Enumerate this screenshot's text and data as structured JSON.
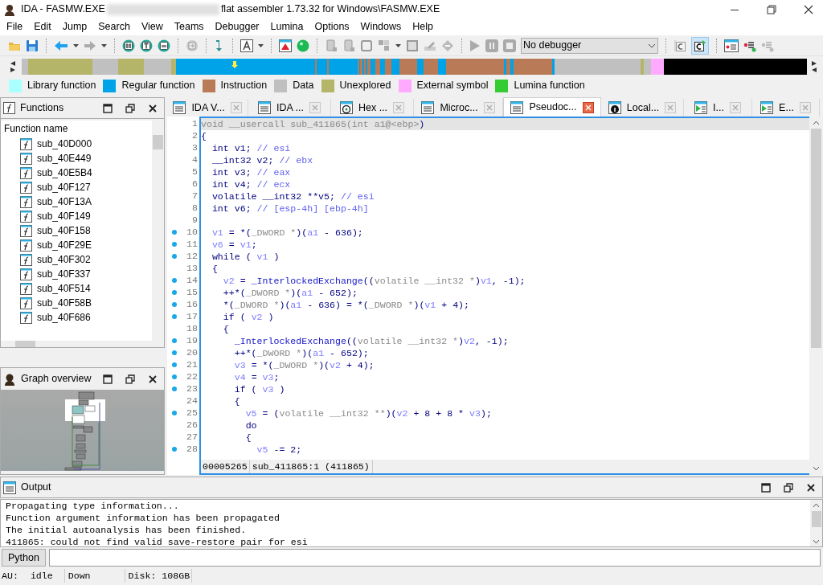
{
  "window": {
    "title_start": "IDA - FASMW.EXE",
    "title_end": "flat assembler 1.73.32 for Windows\\FASMW.EXE"
  },
  "menu": [
    "File",
    "Edit",
    "Jump",
    "Search",
    "View",
    "Teams",
    "Debugger",
    "Lumina",
    "Options",
    "Windows",
    "Help"
  ],
  "toolbar": {
    "debugger_select": "No debugger",
    "pseudocode_toggle_on": true
  },
  "legend": [
    {
      "label": "Library function",
      "color": "#aaffff"
    },
    {
      "label": "Regular function",
      "color": "#00a2e8"
    },
    {
      "label": "Instruction",
      "color": "#b97a57"
    },
    {
      "label": "Data",
      "color": "#c0c0c0"
    },
    {
      "label": "Unexplored",
      "color": "#b5b56a"
    },
    {
      "label": "External symbol",
      "color": "#ffaaff"
    },
    {
      "label": "Lumina function",
      "color": "#33cc33"
    }
  ],
  "functions_panel": {
    "title": "Functions",
    "column": "Function name",
    "items": [
      "sub_40D000",
      "sub_40E449",
      "sub_40E5B4",
      "sub_40F127",
      "sub_40F13A",
      "sub_40F149",
      "sub_40F158",
      "sub_40F29E",
      "sub_40F302",
      "sub_40F337",
      "sub_40F514",
      "sub_40F58B",
      "sub_40F686"
    ]
  },
  "graph_panel": {
    "title": "Graph overview"
  },
  "tabs": [
    {
      "label": "IDA V...",
      "kind": "listing",
      "selected": false
    },
    {
      "label": "IDA ...",
      "kind": "listing",
      "selected": false
    },
    {
      "label": "Hex ...",
      "kind": "hex",
      "selected": false
    },
    {
      "label": "Microc...",
      "kind": "listing",
      "selected": false
    },
    {
      "label": "Pseudoc...",
      "kind": "listing",
      "selected": true
    },
    {
      "label": "Local...",
      "kind": "info",
      "selected": false
    },
    {
      "label": "I...",
      "kind": "table",
      "selected": false
    },
    {
      "label": "E...",
      "kind": "table",
      "selected": false
    }
  ],
  "code": {
    "lines": [
      {
        "number": "1",
        "dot": false,
        "highlighted": true,
        "segments": [
          {
            "kind": "cast",
            "text": "void __usercall sub_411865(int a1@<ebp>"
          },
          {
            "kind": "plain",
            "text": ")"
          }
        ]
      },
      {
        "number": "2",
        "dot": false,
        "highlighted": false,
        "segments": [
          {
            "kind": "plain",
            "text": "{"
          }
        ]
      },
      {
        "number": "3",
        "dot": false,
        "highlighted": false,
        "segments": [
          {
            "kind": "plain",
            "text": "  int v1; "
          },
          {
            "kind": "comment",
            "text": "// esi"
          }
        ]
      },
      {
        "number": "4",
        "dot": false,
        "highlighted": false,
        "segments": [
          {
            "kind": "plain",
            "text": "  __int32 v2; "
          },
          {
            "kind": "comment",
            "text": "// ebx"
          }
        ]
      },
      {
        "number": "5",
        "dot": false,
        "highlighted": false,
        "segments": [
          {
            "kind": "plain",
            "text": "  int v3; "
          },
          {
            "kind": "comment",
            "text": "// eax"
          }
        ]
      },
      {
        "number": "6",
        "dot": false,
        "highlighted": false,
        "segments": [
          {
            "kind": "plain",
            "text": "  int v4; "
          },
          {
            "kind": "comment",
            "text": "// ecx"
          }
        ]
      },
      {
        "number": "7",
        "dot": false,
        "highlighted": false,
        "segments": [
          {
            "kind": "plain",
            "text": "  volatile __int32 **v5; "
          },
          {
            "kind": "comment",
            "text": "// esi"
          }
        ]
      },
      {
        "number": "8",
        "dot": false,
        "highlighted": false,
        "segments": [
          {
            "kind": "plain",
            "text": "  int v6; "
          },
          {
            "kind": "comment",
            "text": "// [esp-4h] [ebp-4h]"
          }
        ]
      },
      {
        "number": "9",
        "dot": false,
        "highlighted": false
      },
      {
        "number": "10",
        "dot": true,
        "highlighted": false,
        "segments": [
          {
            "kind": "var",
            "text": "  v1"
          },
          {
            "kind": "plain",
            "text": " = *("
          },
          {
            "kind": "cast",
            "text": "_DWORD *"
          },
          {
            "kind": "plain",
            "text": ")("
          },
          {
            "kind": "var",
            "text": "a1"
          },
          {
            "kind": "plain",
            "text": " - 636);"
          }
        ]
      },
      {
        "number": "11",
        "dot": true,
        "highlighted": false,
        "segments": [
          {
            "kind": "var",
            "text": "  v6"
          },
          {
            "kind": "plain",
            "text": " = "
          },
          {
            "kind": "var",
            "text": "v1"
          },
          {
            "kind": "plain",
            "text": ";"
          }
        ]
      },
      {
        "number": "12",
        "dot": true,
        "highlighted": false,
        "segments": [
          {
            "kind": "plain",
            "text": "  while ( "
          },
          {
            "kind": "var",
            "text": "v1"
          },
          {
            "kind": "plain",
            "text": " )"
          }
        ]
      },
      {
        "number": "13",
        "dot": false,
        "highlighted": false,
        "segments": [
          {
            "kind": "plain",
            "text": "  {"
          }
        ]
      },
      {
        "number": "14",
        "dot": true,
        "highlighted": false,
        "segments": [
          {
            "kind": "var",
            "text": "    v2"
          },
          {
            "kind": "plain",
            "text": " = "
          },
          {
            "kind": "func",
            "text": "_InterlockedExchange"
          },
          {
            "kind": "plain",
            "text": "(("
          },
          {
            "kind": "cast",
            "text": "volatile __int32 *"
          },
          {
            "kind": "plain",
            "text": ")"
          },
          {
            "kind": "var",
            "text": "v1"
          },
          {
            "kind": "plain",
            "text": ", -1);"
          }
        ]
      },
      {
        "number": "15",
        "dot": true,
        "highlighted": false,
        "segments": [
          {
            "kind": "plain",
            "text": "    ++*("
          },
          {
            "kind": "cast",
            "text": "_DWORD *"
          },
          {
            "kind": "plain",
            "text": ")("
          },
          {
            "kind": "var",
            "text": "a1"
          },
          {
            "kind": "plain",
            "text": " - 652);"
          }
        ]
      },
      {
        "number": "16",
        "dot": true,
        "highlighted": false,
        "segments": [
          {
            "kind": "plain",
            "text": "    *("
          },
          {
            "kind": "cast",
            "text": "_DWORD *"
          },
          {
            "kind": "plain",
            "text": ")("
          },
          {
            "kind": "var",
            "text": "a1"
          },
          {
            "kind": "plain",
            "text": " - 636) = *("
          },
          {
            "kind": "cast",
            "text": "_DWORD *"
          },
          {
            "kind": "plain",
            "text": ")("
          },
          {
            "kind": "var",
            "text": "v1"
          },
          {
            "kind": "plain",
            "text": " + 4);"
          }
        ]
      },
      {
        "number": "17",
        "dot": true,
        "highlighted": false,
        "segments": [
          {
            "kind": "plain",
            "text": "    if ( "
          },
          {
            "kind": "var",
            "text": "v2"
          },
          {
            "kind": "plain",
            "text": " )"
          }
        ]
      },
      {
        "number": "18",
        "dot": false,
        "highlighted": false,
        "segments": [
          {
            "kind": "plain",
            "text": "    {"
          }
        ]
      },
      {
        "number": "19",
        "dot": true,
        "highlighted": false,
        "segments": [
          {
            "kind": "func",
            "text": "      _InterlockedExchange"
          },
          {
            "kind": "plain",
            "text": "(("
          },
          {
            "kind": "cast",
            "text": "volatile __int32 *"
          },
          {
            "kind": "plain",
            "text": ")"
          },
          {
            "kind": "var",
            "text": "v2"
          },
          {
            "kind": "plain",
            "text": ", -1);"
          }
        ]
      },
      {
        "number": "20",
        "dot": true,
        "highlighted": false,
        "segments": [
          {
            "kind": "plain",
            "text": "      ++*("
          },
          {
            "kind": "cast",
            "text": "_DWORD *"
          },
          {
            "kind": "plain",
            "text": ")("
          },
          {
            "kind": "var",
            "text": "a1"
          },
          {
            "kind": "plain",
            "text": " - 652);"
          }
        ]
      },
      {
        "number": "21",
        "dot": true,
        "highlighted": false,
        "segments": [
          {
            "kind": "var",
            "text": "      v3"
          },
          {
            "kind": "plain",
            "text": " = *("
          },
          {
            "kind": "cast",
            "text": "_DWORD *"
          },
          {
            "kind": "plain",
            "text": ")("
          },
          {
            "kind": "var",
            "text": "v2"
          },
          {
            "kind": "plain",
            "text": " + 4);"
          }
        ]
      },
      {
        "number": "22",
        "dot": true,
        "highlighted": false,
        "segments": [
          {
            "kind": "var",
            "text": "      v4"
          },
          {
            "kind": "plain",
            "text": " = "
          },
          {
            "kind": "var",
            "text": "v3"
          },
          {
            "kind": "plain",
            "text": ";"
          }
        ]
      },
      {
        "number": "23",
        "dot": true,
        "highlighted": false,
        "segments": [
          {
            "kind": "plain",
            "text": "      if ( "
          },
          {
            "kind": "var",
            "text": "v3"
          },
          {
            "kind": "plain",
            "text": " )"
          }
        ]
      },
      {
        "number": "24",
        "dot": false,
        "highlighted": false,
        "segments": [
          {
            "kind": "plain",
            "text": "      {"
          }
        ]
      },
      {
        "number": "25",
        "dot": true,
        "highlighted": false,
        "segments": [
          {
            "kind": "var",
            "text": "        v5"
          },
          {
            "kind": "plain",
            "text": " = ("
          },
          {
            "kind": "cast",
            "text": "volatile __int32 **"
          },
          {
            "kind": "plain",
            "text": ")("
          },
          {
            "kind": "var",
            "text": "v2"
          },
          {
            "kind": "plain",
            "text": " + 8 + 8 * "
          },
          {
            "kind": "var",
            "text": "v3"
          },
          {
            "kind": "plain",
            "text": ");"
          }
        ]
      },
      {
        "number": "26",
        "dot": false,
        "highlighted": false,
        "segments": [
          {
            "kind": "plain",
            "text": "        do"
          }
        ]
      },
      {
        "number": "27",
        "dot": false,
        "highlighted": false,
        "segments": [
          {
            "kind": "plain",
            "text": "        {"
          }
        ]
      },
      {
        "number": "28",
        "dot": true,
        "highlighted": false,
        "segments": [
          {
            "kind": "var",
            "text": "          v5"
          },
          {
            "kind": "plain",
            "text": " -= 2;"
          }
        ]
      }
    ],
    "status_address": "00005265",
    "status_location": "sub_411865:1 (411865)"
  },
  "output": {
    "title": "Output",
    "lines": [
      "Propagating type information...",
      "Function argument information has been propagated",
      "The initial autoanalysis has been finished.",
      "411865: could not find valid save-restore pair for esi"
    ],
    "language_button": "Python"
  },
  "status_bar": {
    "au_label": "AU:",
    "au_state": "idle",
    "direction": "Down",
    "disk": "Disk: 108GB"
  }
}
